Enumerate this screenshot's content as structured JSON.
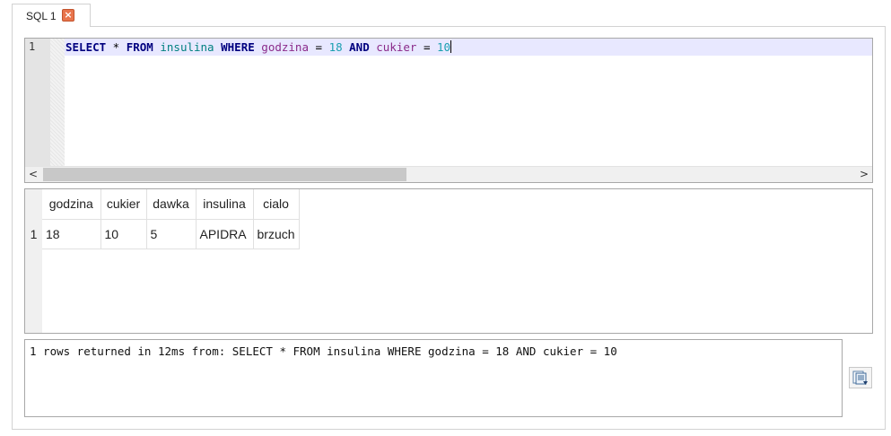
{
  "tabs": [
    {
      "label": "SQL 1",
      "close_icon": "close-icon"
    }
  ],
  "editor": {
    "line_number": "1",
    "query_tokens": [
      {
        "text": "SELECT",
        "type": "kw"
      },
      {
        "text": " * ",
        "type": "op"
      },
      {
        "text": "FROM",
        "type": "kw"
      },
      {
        "text": " ",
        "type": "op"
      },
      {
        "text": "insulina",
        "type": "tbl"
      },
      {
        "text": " ",
        "type": "op"
      },
      {
        "text": "WHERE",
        "type": "kw"
      },
      {
        "text": " ",
        "type": "op"
      },
      {
        "text": "godzina",
        "type": "col"
      },
      {
        "text": " = ",
        "type": "op"
      },
      {
        "text": "18",
        "type": "num"
      },
      {
        "text": " ",
        "type": "op"
      },
      {
        "text": "AND",
        "type": "kw"
      },
      {
        "text": " ",
        "type": "op"
      },
      {
        "text": "cukier",
        "type": "col"
      },
      {
        "text": " = ",
        "type": "op"
      },
      {
        "text": "10",
        "type": "num"
      }
    ],
    "scroll_left_icon": "<",
    "scroll_right_icon": ">"
  },
  "results": {
    "columns": [
      "godzina",
      "cukier",
      "dawka",
      "insulina",
      "cialo"
    ],
    "rows": [
      {
        "row_number": "1",
        "cells": [
          "18",
          "10",
          "5",
          "APIDRA",
          "brzuch"
        ]
      }
    ]
  },
  "log": {
    "message": "1 rows returned in 12ms from: SELECT * FROM insulina WHERE godzina = 18 AND cukier = 10"
  },
  "export_button": {
    "icon": "export-icon"
  }
}
